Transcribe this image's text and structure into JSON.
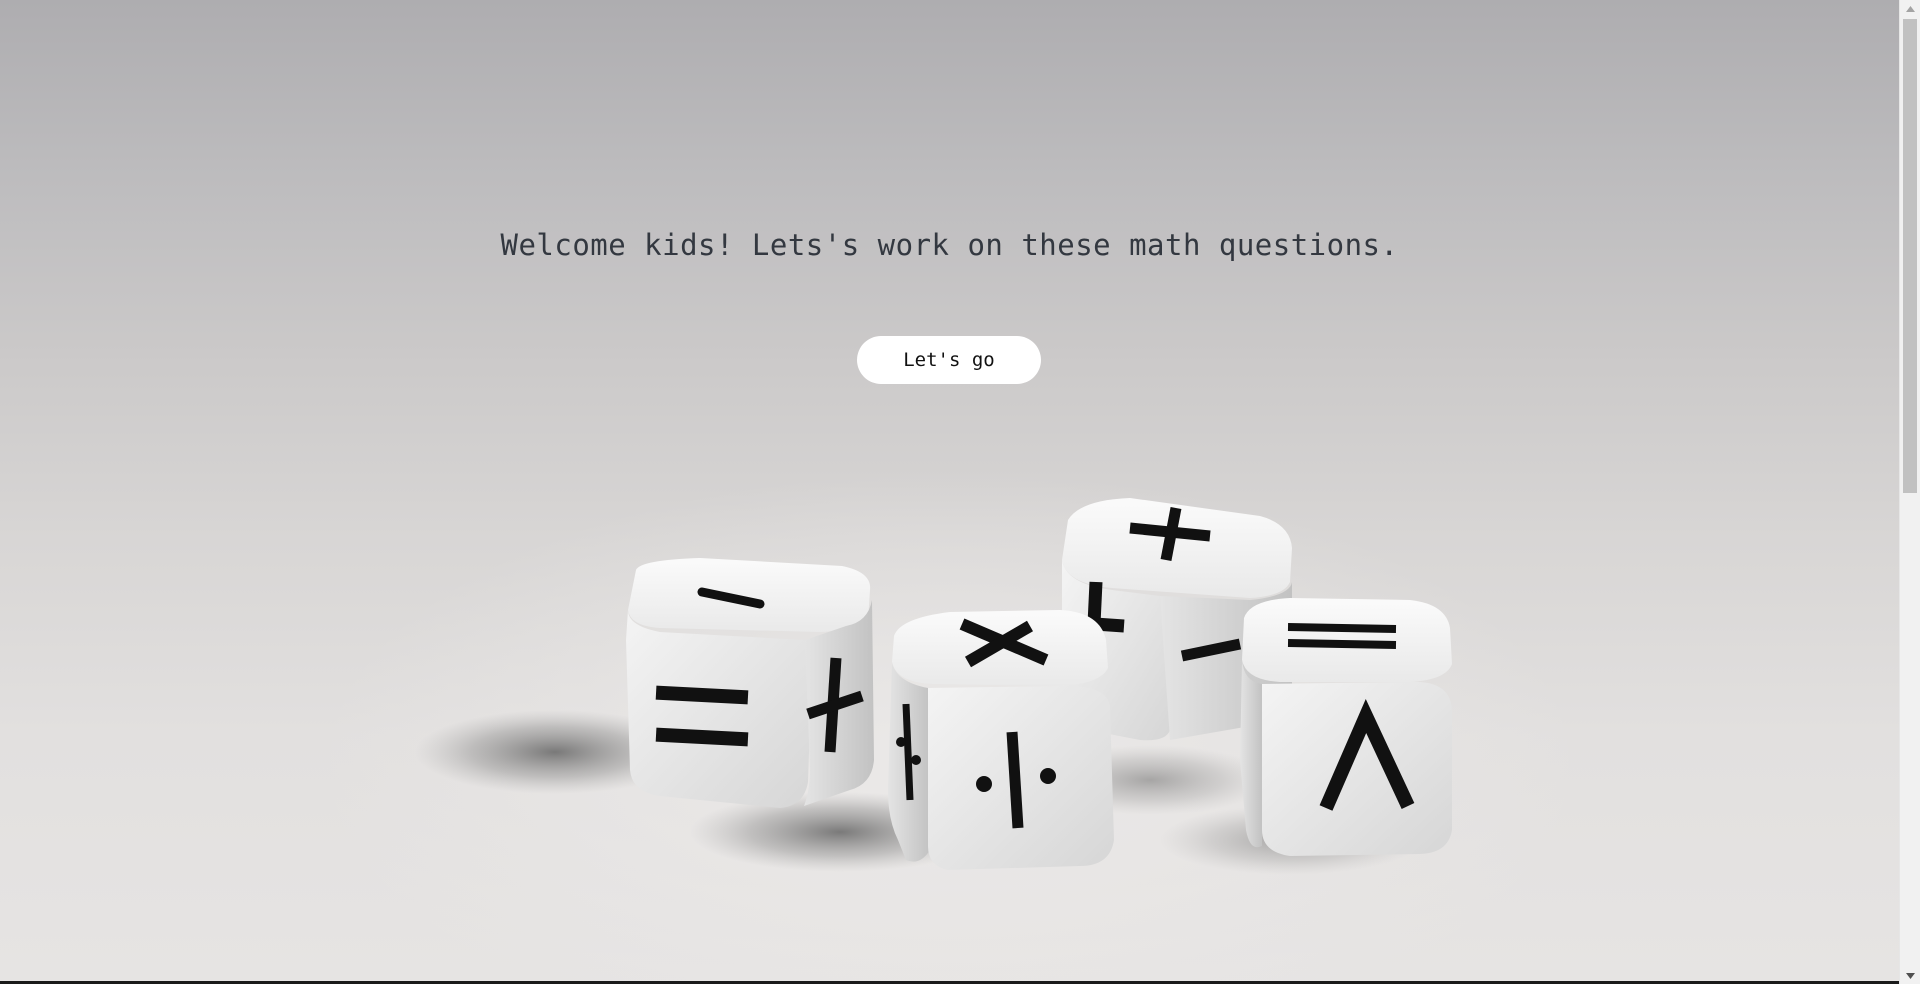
{
  "hero": {
    "welcome_text": "Welcome kids! Lets's work on these math questions.",
    "button_label": "Let's go"
  },
  "scene": {
    "description_icon": "math-dice-icon",
    "dice": [
      {
        "top_symbol": "−",
        "front_symbol": "=",
        "side_symbol": "+"
      },
      {
        "top_symbol": "×",
        "front_symbol": "÷",
        "side_symbol": "÷"
      },
      {
        "top_symbol": "+",
        "front_symbol": "+",
        "side_symbol": "−"
      },
      {
        "top_symbol": "=",
        "front_symbol": "^",
        "side_symbol": ""
      }
    ]
  },
  "scrollbar": {
    "up_icon": "scroll-up-arrow-icon",
    "down_icon": "scroll-down-arrow-icon"
  },
  "colors": {
    "text": "#333840",
    "button_bg": "#ffffff",
    "die_face": "#f2f2f2",
    "symbol": "#111111"
  }
}
